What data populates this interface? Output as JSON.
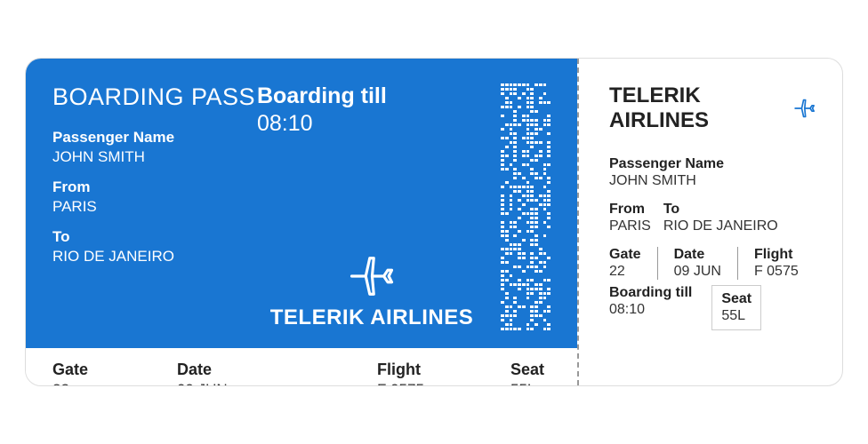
{
  "title": "BOARDING PASS",
  "airline": "TELERIK AIRLINES",
  "passenger": {
    "label": "Passenger Name",
    "value": "JOHN SMITH"
  },
  "from": {
    "label": "From",
    "value": "PARIS"
  },
  "to": {
    "label": "To",
    "value": "RIO DE JANEIRO"
  },
  "boarding": {
    "label": "Boarding till",
    "value": "08:10"
  },
  "gate": {
    "label": "Gate",
    "value": "22"
  },
  "date": {
    "label": "Date",
    "value": "09 JUN"
  },
  "flight": {
    "label": "Flight",
    "value": "F 0575"
  },
  "seat": {
    "label": "Seat",
    "value": "55L"
  }
}
